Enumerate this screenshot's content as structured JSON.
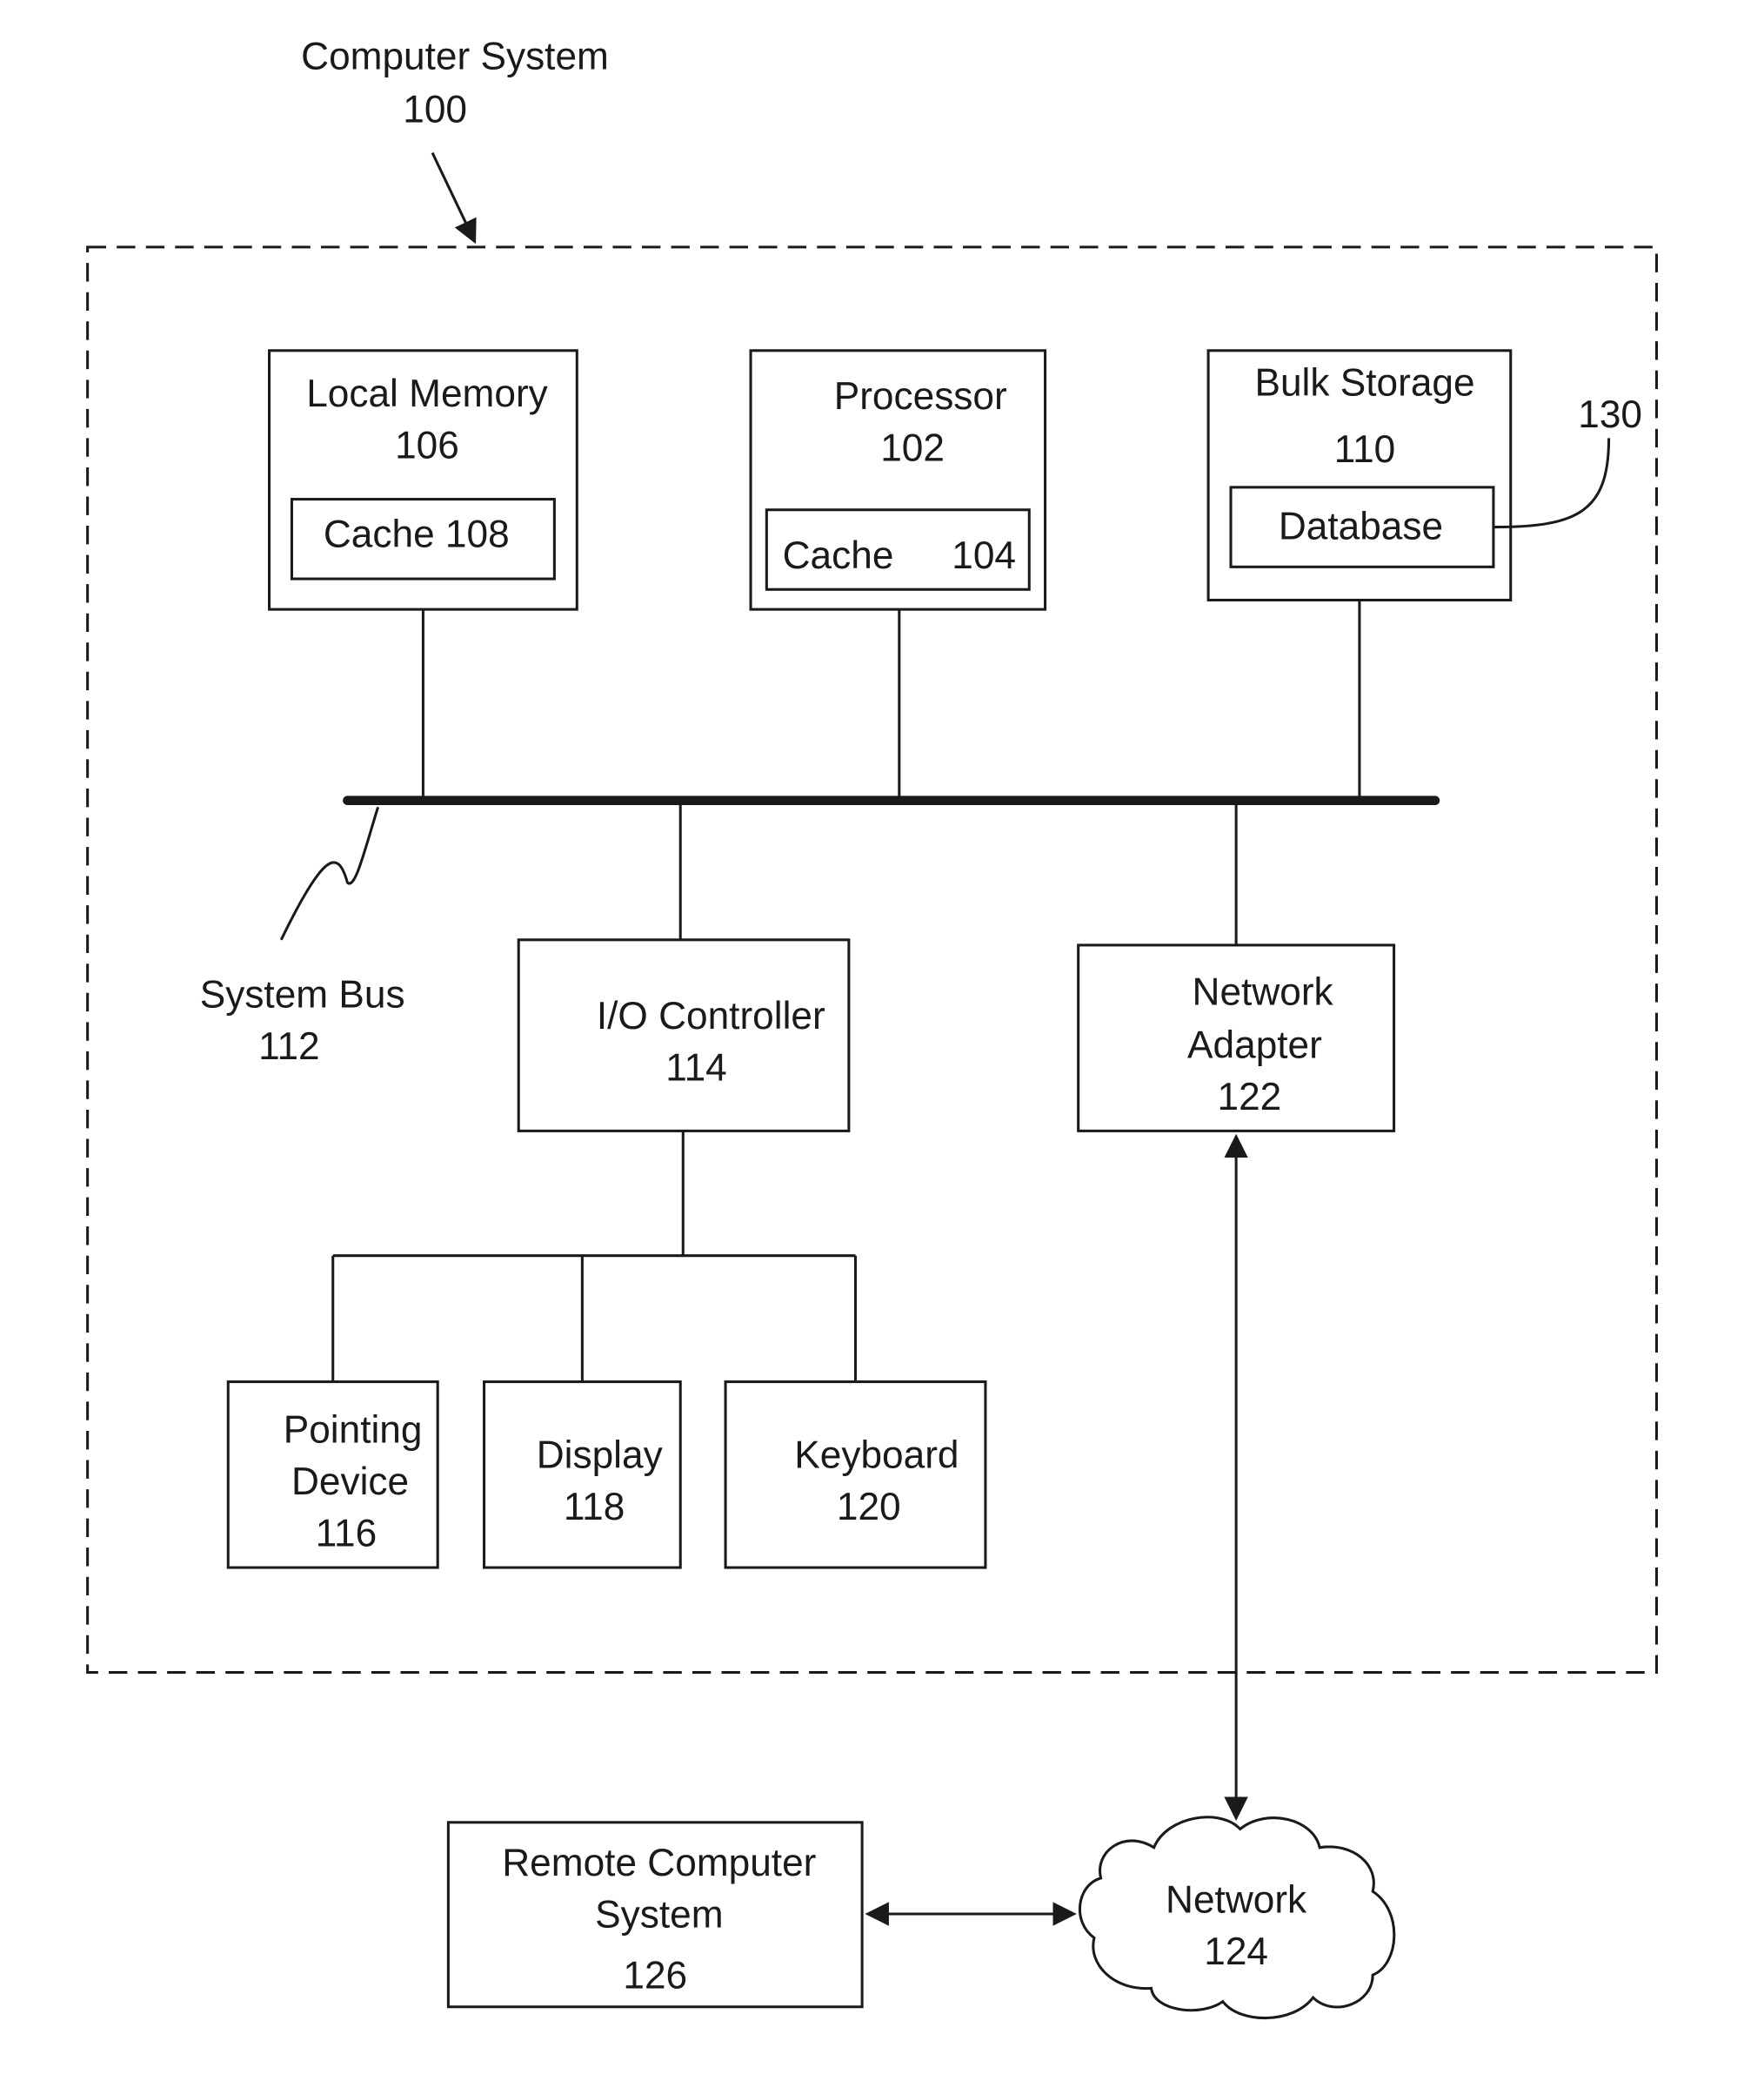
{
  "diagram": {
    "system": {
      "title": "Computer System",
      "ref": "100"
    },
    "local_memory": {
      "title": "Local Memory",
      "ref": "106",
      "cache": "Cache 108"
    },
    "processor": {
      "title": "Processor",
      "ref": "102",
      "cache_label": "Cache",
      "cache_ref": "104"
    },
    "bulk_storage": {
      "title": "Bulk Storage",
      "ref": "110",
      "database": "Database",
      "database_ref": "130"
    },
    "system_bus": {
      "title": "System Bus",
      "ref": "112"
    },
    "io_controller": {
      "title": "I/O Controller",
      "ref": "114"
    },
    "network_adapter": {
      "line1": "Network",
      "line2": "Adapter",
      "ref": "122"
    },
    "pointing_device": {
      "line1": "Pointing",
      "line2": "Device",
      "ref": "116"
    },
    "display": {
      "title": "Display",
      "ref": "118"
    },
    "keyboard": {
      "title": "Keyboard",
      "ref": "120"
    },
    "remote_system": {
      "line1": "Remote Computer",
      "line2": "System",
      "ref": "126"
    },
    "network": {
      "title": "Network",
      "ref": "124"
    }
  }
}
